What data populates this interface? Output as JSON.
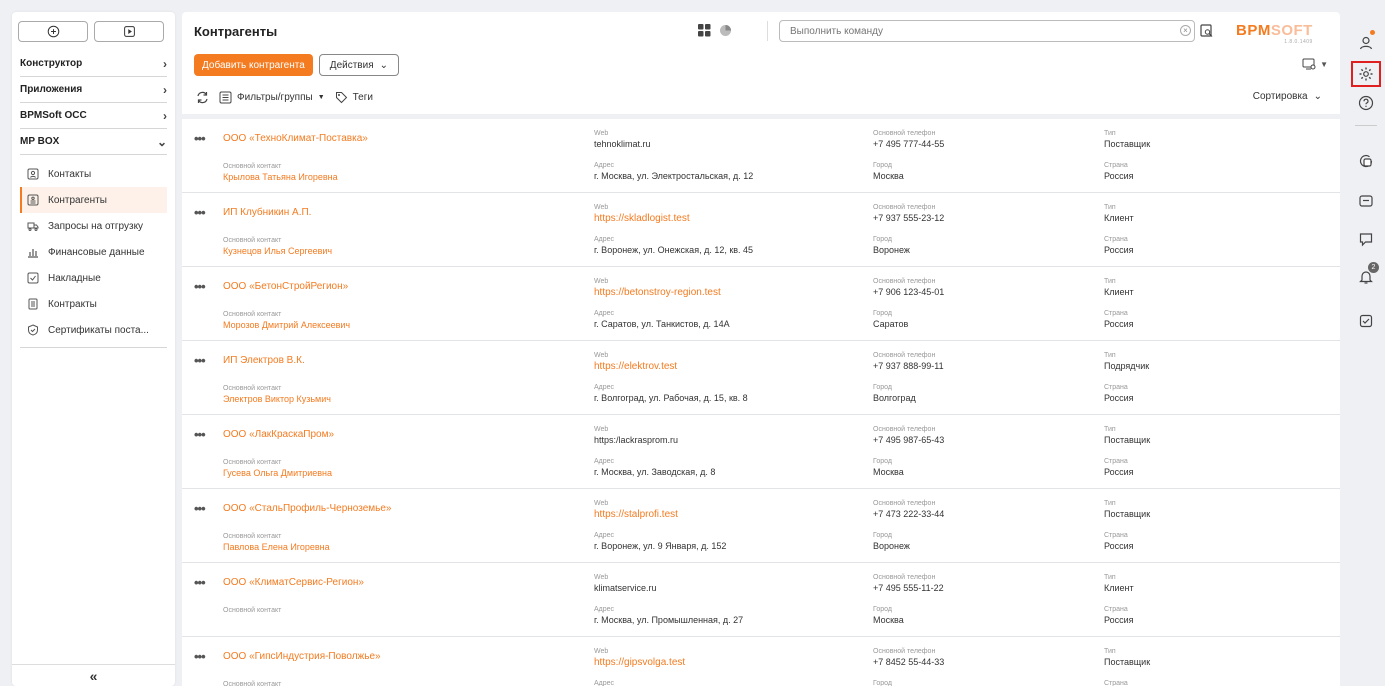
{
  "sidebar": {
    "sections": [
      {
        "label": "Конструктор"
      },
      {
        "label": "Приложения"
      },
      {
        "label": "BPMSoft OCC"
      },
      {
        "label": "MP BOX"
      }
    ],
    "items": [
      {
        "label": "Контакты",
        "icon": "contact-card-icon"
      },
      {
        "label": "Контрагенты",
        "icon": "accounts-icon",
        "active": true
      },
      {
        "label": "Запросы на отгрузку",
        "icon": "truck-icon"
      },
      {
        "label": "Финансовые данные",
        "icon": "bar-chart-icon"
      },
      {
        "label": "Накладные",
        "icon": "checkbox-doc-icon"
      },
      {
        "label": "Контракты",
        "icon": "document-icon"
      },
      {
        "label": "Сертификаты поста...",
        "icon": "shield-check-icon"
      }
    ],
    "collapse_glyph": "«"
  },
  "header": {
    "title": "Контрагенты",
    "command_placeholder": "Выполнить команду",
    "logo_main": "BPM",
    "logo_soft": "SOFT",
    "version": "1.8.0.1409"
  },
  "toolbar": {
    "add_label": "Добавить контрагента",
    "actions_label": "Действия",
    "filters_label": "Фильтры/группы",
    "tags_label": "Теги",
    "sort_label": "Сортировка"
  },
  "labels": {
    "contact": "Основной контакт",
    "web": "Web",
    "address": "Адрес",
    "phone": "Основной телефон",
    "city": "Город",
    "type": "Тип",
    "country": "Страна"
  },
  "accounts": [
    {
      "name": "ООО «ТехноКлимат-Поставка»",
      "contact": "Крылова Татьяна Игоревна",
      "web": "tehnoklimat.ru",
      "web_link": false,
      "address": "г. Москва, ул. Электростальская, д. 12",
      "phone": "+7 495 777-44-55",
      "city": "Москва",
      "type": "Поставщик",
      "country": "Россия"
    },
    {
      "name": "ИП Клубникин А.П.",
      "contact": "Кузнецов Илья Сергеевич",
      "web": "https://skladlogist.test",
      "web_link": true,
      "address": "г. Воронеж, ул. Онежская, д. 12, кв. 45",
      "phone": "+7 937 555-23-12",
      "city": "Воронеж",
      "type": "Клиент",
      "country": "Россия"
    },
    {
      "name": "ООО «БетонСтройРегион»",
      "contact": "Морозов Дмитрий Алексеевич",
      "web": "https://betonstroy-region.test",
      "web_link": true,
      "address": "г. Саратов, ул. Танкистов, д. 14А",
      "phone": "+7 906 123-45-01",
      "city": "Саратов",
      "type": "Клиент",
      "country": "Россия"
    },
    {
      "name": "ИП Электров В.К.",
      "contact": "Электров Виктор Кузьмич",
      "web": "https://elektrov.test",
      "web_link": true,
      "address": "г. Волгоград, ул. Рабочая, д. 15, кв. 8",
      "phone": "+7 937 888-99-11",
      "city": "Волгоград",
      "type": "Подрядчик",
      "country": "Россия"
    },
    {
      "name": "ООО «ЛакКраскаПром»",
      "contact": "Гусева Ольга Дмитриевна",
      "web": "https:/lackrasprom.ru",
      "web_link": false,
      "address": "г. Москва, ул. Заводская, д. 8",
      "phone": "+7 495 987-65-43",
      "city": "Москва",
      "type": "Поставщик",
      "country": "Россия"
    },
    {
      "name": "ООО «СтальПрофиль-Черноземье»",
      "contact": "Павлова Елена Игоревна",
      "web": "https://stalprofi.test",
      "web_link": true,
      "address": "г. Воронеж, ул. 9 Января, д. 152",
      "phone": "+7 473 222-33-44",
      "city": "Воронеж",
      "type": "Поставщик",
      "country": "Россия"
    },
    {
      "name": "ООО «КлиматСервис-Регион»",
      "contact": "",
      "web": "klimatservice.ru",
      "web_link": false,
      "address": "г. Москва, ул. Промышленная, д. 27",
      "phone": "+7 495 555-11-22",
      "city": "Москва",
      "type": "Клиент",
      "country": "Россия"
    },
    {
      "name": "ООО «ГипсИндустрия-Поволжье»",
      "contact": "",
      "web": "https://gipsvolga.test",
      "web_link": true,
      "address": "",
      "phone": "+7 8452 55-44-33",
      "city": "",
      "type": "Поставщик",
      "country": ""
    }
  ],
  "rail": {
    "notifications_badge": "2"
  },
  "colors": {
    "accent": "#f47b20",
    "highlight_border": "#e02020"
  }
}
